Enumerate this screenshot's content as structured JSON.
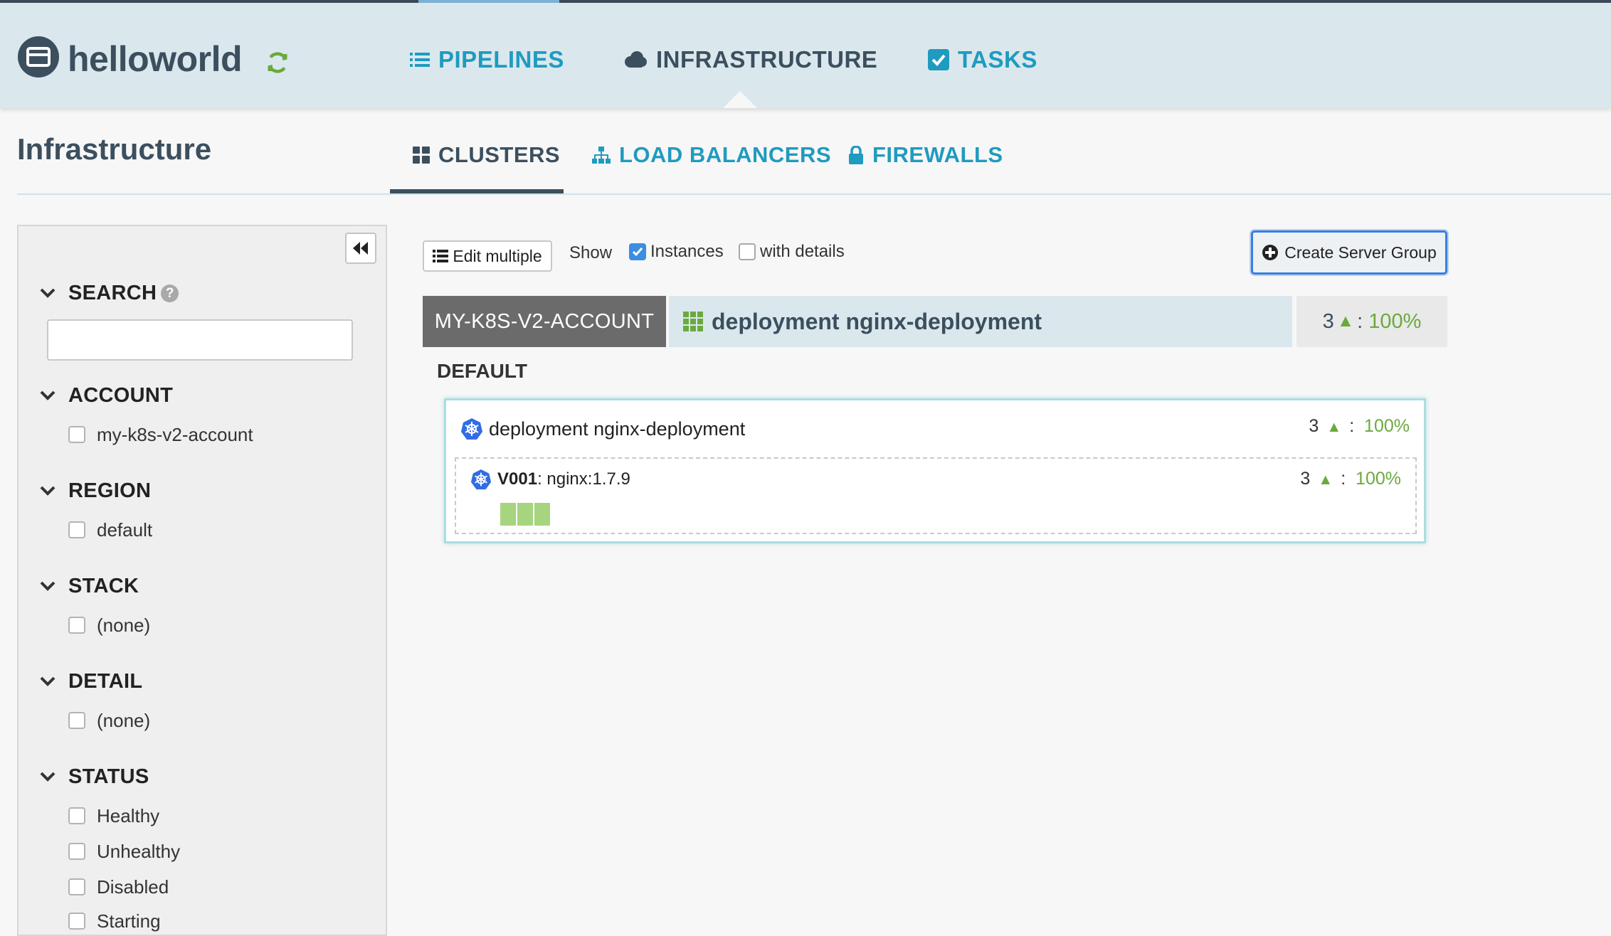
{
  "app": {
    "name": "helloworld"
  },
  "nav": {
    "pipelines": "PIPELINES",
    "infrastructure": "INFRASTRUCTURE",
    "tasks": "TASKS"
  },
  "page": {
    "title": "Infrastructure"
  },
  "subtabs": {
    "clusters": "CLUSTERS",
    "load_balancers": "LOAD BALANCERS",
    "firewalls": "FIREWALLS"
  },
  "sidebar": {
    "search": {
      "label": "SEARCH",
      "value": "",
      "placeholder": ""
    },
    "account": {
      "label": "ACCOUNT",
      "options": [
        "my-k8s-v2-account"
      ]
    },
    "region": {
      "label": "REGION",
      "options": [
        "default"
      ]
    },
    "stack": {
      "label": "STACK",
      "options": [
        "(none)"
      ]
    },
    "detail": {
      "label": "DETAIL",
      "options": [
        "(none)"
      ]
    },
    "status": {
      "label": "STATUS",
      "options": [
        "Healthy",
        "Unhealthy",
        "Disabled",
        "Starting"
      ]
    }
  },
  "toolbar": {
    "edit_multiple": "Edit multiple",
    "show": "Show",
    "instances": "Instances",
    "instances_checked": true,
    "with_details": "with details",
    "with_details_checked": false,
    "create_server_group": "Create Server Group"
  },
  "cluster": {
    "account": "MY-K8S-V2-ACCOUNT",
    "name": "deployment nginx-deployment",
    "instance_count": "3",
    "health_pct": "100%",
    "region": "DEFAULT",
    "card": {
      "title": "deployment nginx-deployment",
      "instance_count": "3",
      "health_pct": "100%"
    },
    "server_group": {
      "version": "V001",
      "image": "nginx:1.7.9",
      "instance_count": "3",
      "health_pct": "100%",
      "instances": [
        "healthy",
        "healthy",
        "healthy"
      ]
    }
  },
  "colors": {
    "header_bg": "#dae8ee",
    "accent_teal": "#1f9bbf",
    "dark_slate": "#3c4f5e",
    "healthy_green": "#6aaa3d",
    "instance_green": "#a7d47e",
    "k8s_blue": "#326ce5"
  },
  "icons": {
    "logo": "server-window-icon",
    "refresh": "refresh-icon",
    "pipelines": "list-icon",
    "infrastructure": "cloud-icon",
    "tasks": "check-square-icon",
    "clusters": "th-large-icon",
    "load_balancers": "sitemap-icon",
    "firewalls": "lock-icon",
    "k8s": "kubernetes-icon"
  }
}
